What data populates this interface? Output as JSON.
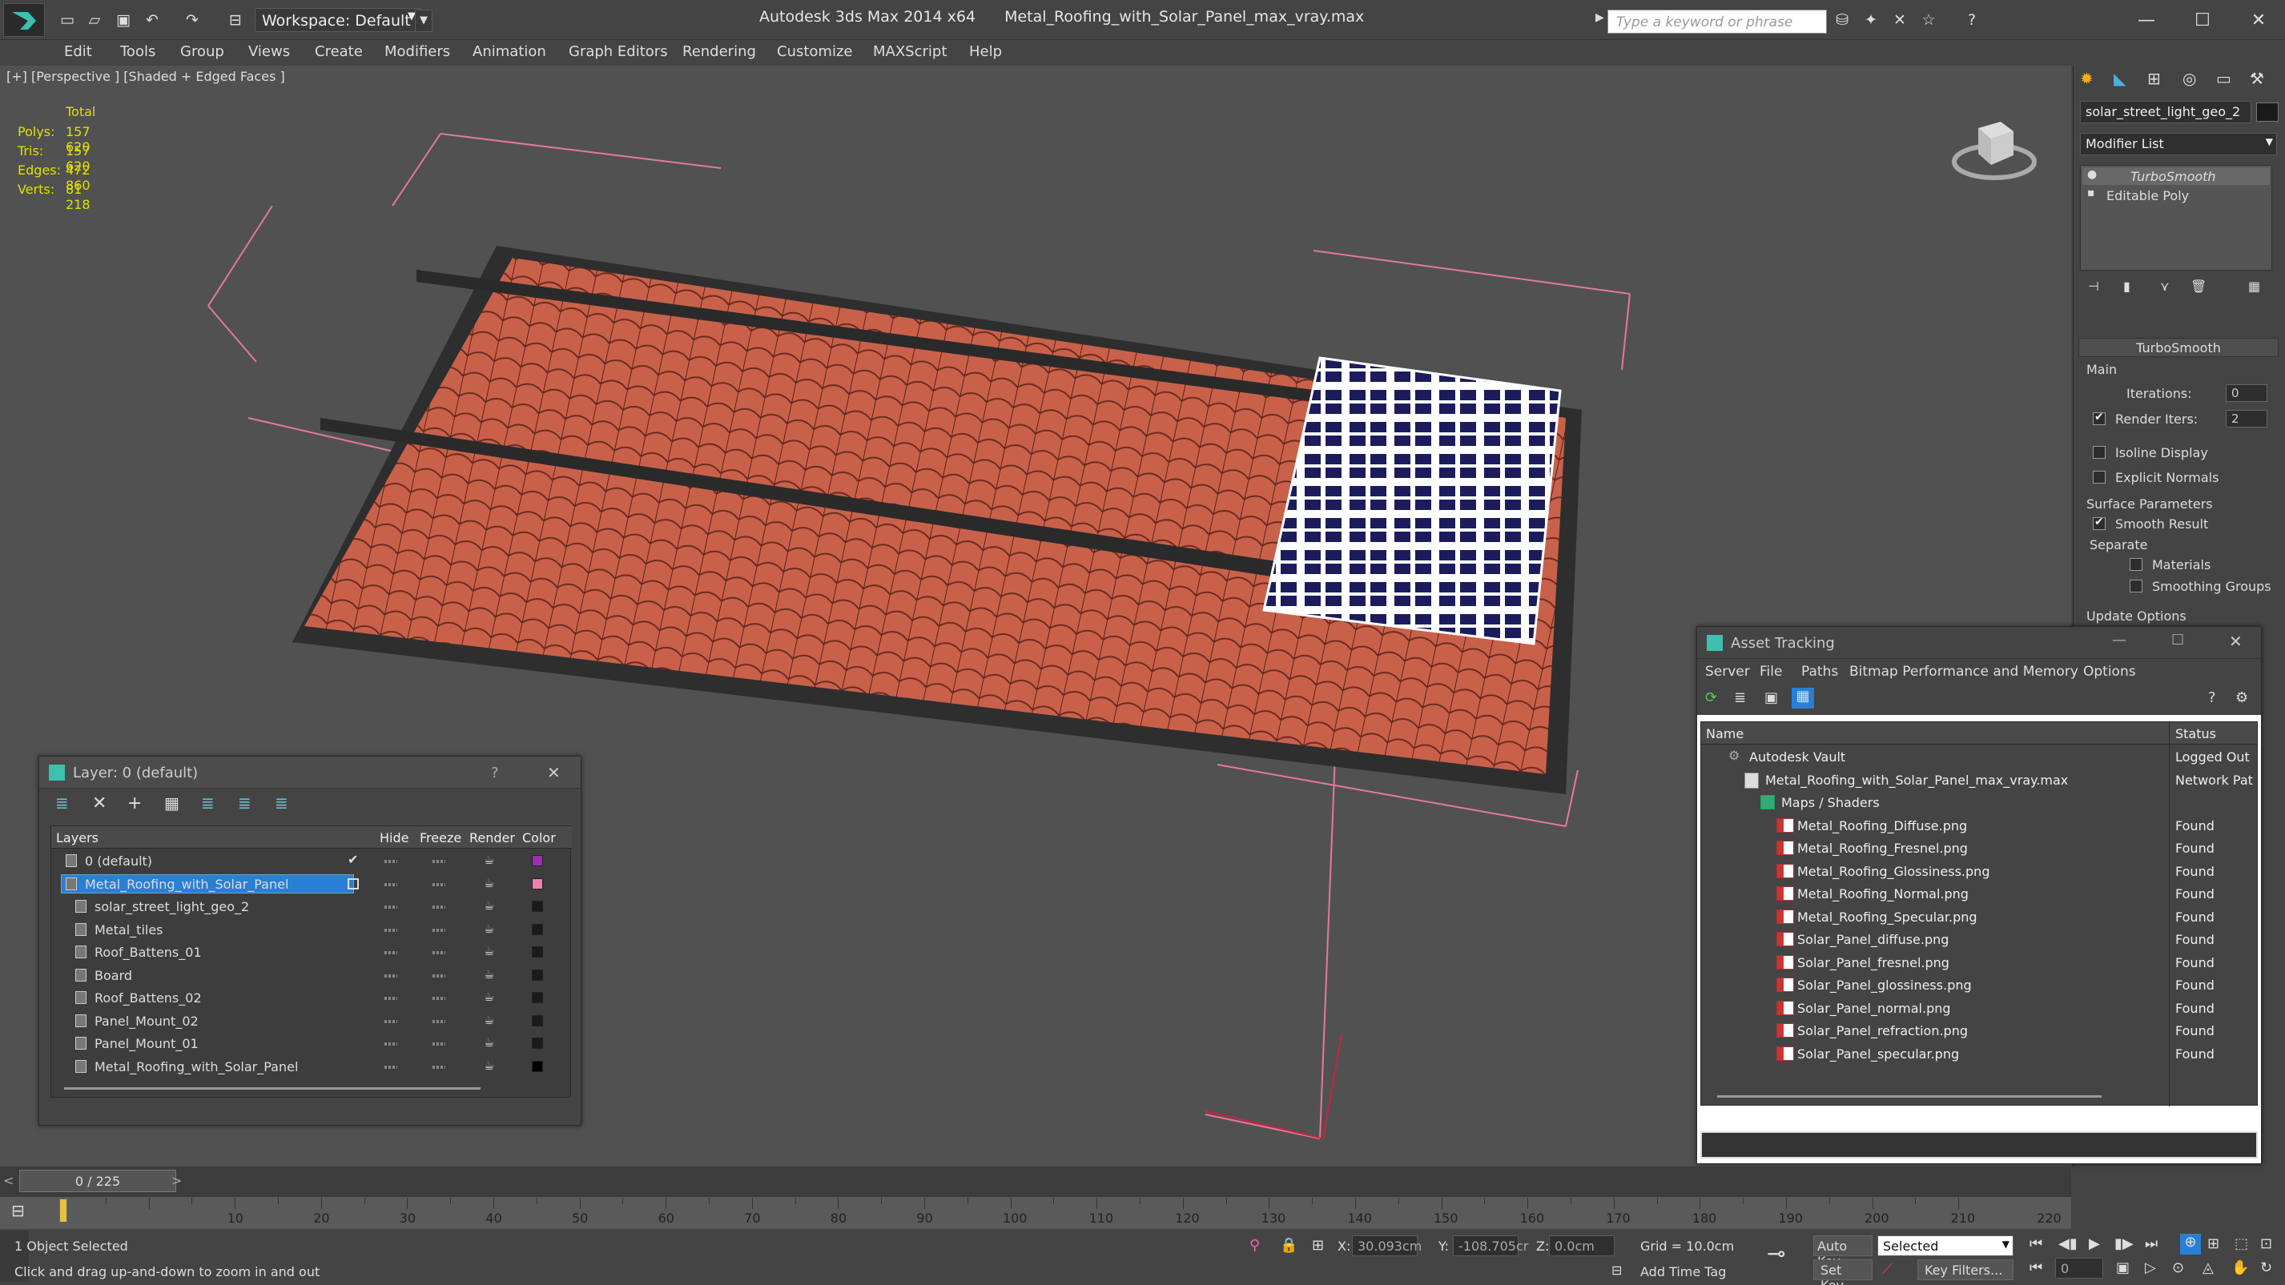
{
  "app": {
    "title": "Autodesk 3ds Max  2014 x64",
    "file": "Metal_Roofing_with_Solar_Panel_max_vray.max",
    "workspace": "Workspace: Default",
    "search_placeholder": "Type a keyword or phrase"
  },
  "menus": [
    "Edit",
    "Tools",
    "Group",
    "Views",
    "Create",
    "Modifiers",
    "Animation",
    "Graph Editors",
    "Rendering",
    "Customize",
    "MAXScript",
    "Help"
  ],
  "viewport": {
    "label": "[+] [Perspective ] [Shaded + Edged Faces ]",
    "stats": {
      "total_label": "Total",
      "rows": [
        {
          "label": "Polys:",
          "value": "157 620"
        },
        {
          "label": "Tris:",
          "value": "157 620"
        },
        {
          "label": "Edges:",
          "value": "472 860"
        },
        {
          "label": "Verts:",
          "value": "81 218"
        }
      ]
    }
  },
  "command_panel": {
    "object_name": "solar_street_light_geo_2",
    "modifier_list": "Modifier List",
    "stack": [
      {
        "name": "TurboSmooth",
        "italic": true
      },
      {
        "name": "Editable Poly",
        "italic": false
      }
    ],
    "turbosmooth": {
      "title": "TurboSmooth",
      "main": "Main",
      "iterations_label": "Iterations:",
      "iterations_value": "0",
      "render_iters_label": "Render Iters:",
      "render_iters_value": "2",
      "isoline": "Isoline Display",
      "explicit_normals": "Explicit Normals",
      "surface_params": "Surface Parameters",
      "smooth_result": "Smooth Result",
      "separate": "Separate",
      "materials": "Materials",
      "smoothing_groups": "Smoothing Groups",
      "update_options": "Update Options"
    }
  },
  "layer_window": {
    "title": "Layer: 0 (default)",
    "help": "?",
    "headers": {
      "layers": "Layers",
      "hide": "Hide",
      "freeze": "Freeze",
      "render": "Render",
      "color": "Color"
    },
    "rows": [
      {
        "name": "0 (default)",
        "indent": 1,
        "current": true,
        "selected": false,
        "color": "#9b2fb0"
      },
      {
        "name": "Metal_Roofing_with_Solar_Panel",
        "indent": 1,
        "current": false,
        "selected": true,
        "color": "#ef7fb3"
      },
      {
        "name": "solar_street_light_geo_2",
        "indent": 2,
        "current": false,
        "selected": false,
        "color": "#1a1a1a"
      },
      {
        "name": "Metal_tiles",
        "indent": 2,
        "current": false,
        "selected": false,
        "color": "#1a1a1a"
      },
      {
        "name": "Roof_Battens_01",
        "indent": 2,
        "current": false,
        "selected": false,
        "color": "#1a1a1a"
      },
      {
        "name": "Board",
        "indent": 2,
        "current": false,
        "selected": false,
        "color": "#1a1a1a"
      },
      {
        "name": "Roof_Battens_02",
        "indent": 2,
        "current": false,
        "selected": false,
        "color": "#1a1a1a"
      },
      {
        "name": "Panel_Mount_02",
        "indent": 2,
        "current": false,
        "selected": false,
        "color": "#1a1a1a"
      },
      {
        "name": "Panel_Mount_01",
        "indent": 2,
        "current": false,
        "selected": false,
        "color": "#1a1a1a"
      },
      {
        "name": "Metal_Roofing_with_Solar_Panel",
        "indent": 2,
        "current": false,
        "selected": false,
        "color": "#000000"
      }
    ]
  },
  "asset_window": {
    "title": "Asset Tracking",
    "menus": [
      "Server",
      "File",
      "Paths",
      "Bitmap Performance and Memory",
      "Options"
    ],
    "headers": {
      "name": "Name",
      "status": "Status"
    },
    "rows": [
      {
        "name": "Autodesk Vault",
        "status": "Logged Out",
        "kind": "vault",
        "indent": 1
      },
      {
        "name": "Metal_Roofing_with_Solar_Panel_max_vray.max",
        "status": "Network Pat",
        "kind": "max",
        "indent": 2
      },
      {
        "name": "Maps / Shaders",
        "status": "",
        "kind": "maps",
        "indent": 3
      },
      {
        "name": "Metal_Roofing_Diffuse.png",
        "status": "Found",
        "kind": "png",
        "indent": 4
      },
      {
        "name": "Metal_Roofing_Fresnel.png",
        "status": "Found",
        "kind": "png",
        "indent": 4
      },
      {
        "name": "Metal_Roofing_Glossiness.png",
        "status": "Found",
        "kind": "png",
        "indent": 4
      },
      {
        "name": "Metal_Roofing_Normal.png",
        "status": "Found",
        "kind": "png",
        "indent": 4
      },
      {
        "name": "Metal_Roofing_Specular.png",
        "status": "Found",
        "kind": "png",
        "indent": 4
      },
      {
        "name": "Solar_Panel_diffuse.png",
        "status": "Found",
        "kind": "png",
        "indent": 4
      },
      {
        "name": "Solar_Panel_fresnel.png",
        "status": "Found",
        "kind": "png",
        "indent": 4
      },
      {
        "name": "Solar_Panel_glossiness.png",
        "status": "Found",
        "kind": "png",
        "indent": 4
      },
      {
        "name": "Solar_Panel_normal.png",
        "status": "Found",
        "kind": "png",
        "indent": 4
      },
      {
        "name": "Solar_Panel_refraction.png",
        "status": "Found",
        "kind": "png",
        "indent": 4
      },
      {
        "name": "Solar_Panel_specular.png",
        "status": "Found",
        "kind": "png",
        "indent": 4
      }
    ]
  },
  "timeline": {
    "frame": "0 / 225",
    "ticks": [
      "0",
      "10",
      "20",
      "30",
      "40",
      "50",
      "60",
      "70",
      "80",
      "90",
      "100",
      "110",
      "120",
      "130",
      "140",
      "150",
      "160",
      "170",
      "180",
      "190",
      "200",
      "210",
      "220"
    ]
  },
  "status": {
    "selection": "1 Object Selected",
    "prompt": "Click and drag up-and-down to zoom in and out",
    "x_label": "X:",
    "x": "30.093cm",
    "y_label": "Y:",
    "y": "-108.705cr",
    "z_label": "Z:",
    "z": "0.0cm",
    "grid": "Grid = 10.0cm",
    "add_time_tag": "Add Time Tag",
    "auto_key": "Auto Key",
    "set_key": "Set Key",
    "selected": "Selected",
    "key_filters": "Key Filters...",
    "frame_value": "0"
  }
}
